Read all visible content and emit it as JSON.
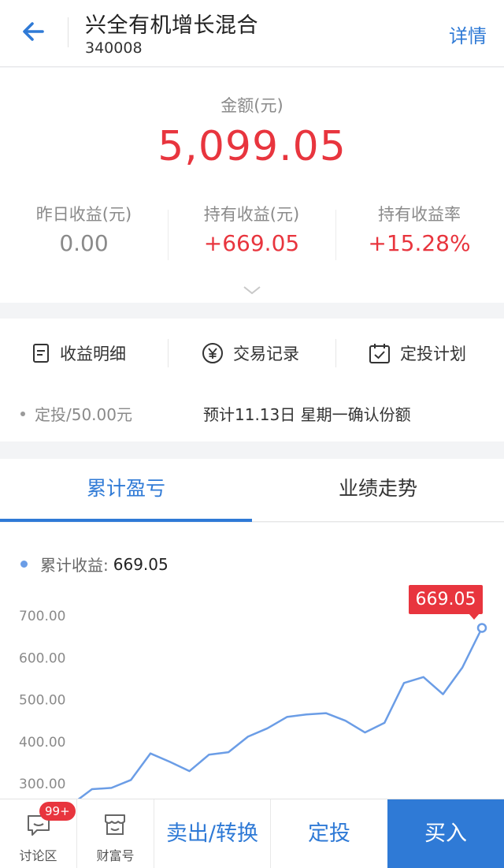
{
  "header": {
    "title": "兴全有机增长混合",
    "code": "340008",
    "detail_label": "详情",
    "back_icon": "arrow-left-icon"
  },
  "summary": {
    "amount_label": "金额(元)",
    "amount_value": "5,099.05",
    "stats": [
      {
        "label": "昨日收益(元)",
        "value": "0.00"
      },
      {
        "label": "持有收益(元)",
        "value": "+669.05"
      },
      {
        "label": "持有收益率",
        "value": "+15.28%"
      }
    ]
  },
  "actions": [
    {
      "label": "收益明细",
      "icon": "document-icon"
    },
    {
      "label": "交易记录",
      "icon": "yen-circle-icon"
    },
    {
      "label": "定投计划",
      "icon": "calendar-check-icon"
    }
  ],
  "sip": {
    "label": "定投/50.00元",
    "note": "预计11.13日 星期一确认份额"
  },
  "tabs": [
    {
      "label": "累计盈亏",
      "active": true
    },
    {
      "label": "业绩走势",
      "active": false
    }
  ],
  "chart_legend": {
    "label": "累计收益:",
    "value": "669.05"
  },
  "callout": "669.05",
  "bottom_bar": {
    "discuss_label": "讨论区",
    "discuss_badge": "99+",
    "wealth_label": "财富号",
    "sell_label": "卖出/转换",
    "sip_label": "定投",
    "buy_label": "买入"
  },
  "colors": {
    "accent": "#2f7ad6",
    "red": "#e8353e",
    "line": "#6b9de6"
  },
  "chart_data": {
    "type": "line",
    "series": [
      {
        "name": "累计收益",
        "values": [
          250,
          285,
          288,
          307,
          370,
          350,
          328,
          367,
          373,
          410,
          430,
          457,
          463,
          466,
          448,
          420,
          443,
          538,
          552,
          511,
          575,
          669.05
        ]
      }
    ],
    "y_ticks": [
      "300.00",
      "400.00",
      "500.00",
      "600.00",
      "700.00"
    ],
    "ylim": [
      270,
      715
    ],
    "grid": false,
    "highlight_last": true
  }
}
